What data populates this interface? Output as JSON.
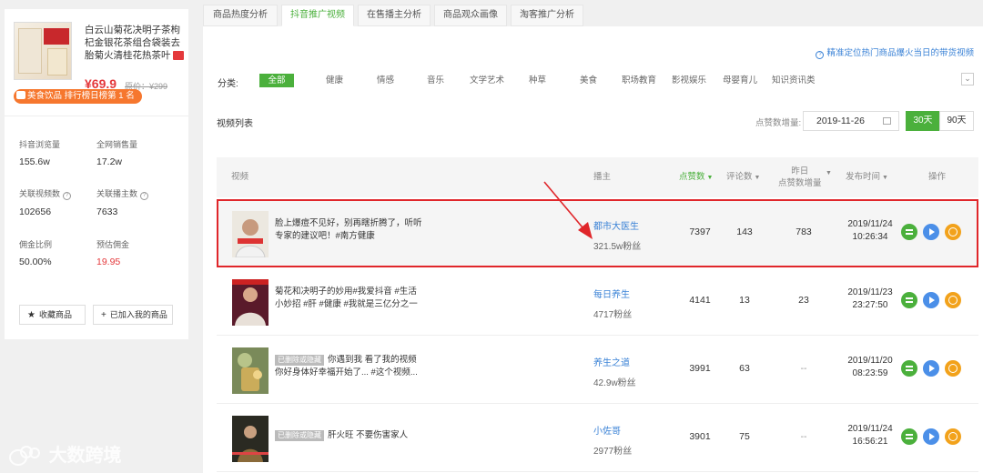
{
  "product": {
    "title": "白云山菊花决明子茶枸杞金银花茶组合袋装去胎菊火清桂花热茶叶",
    "price": "¥69.9",
    "orig_label": "原价",
    "orig_price": "¥299",
    "rank_badge": "美食饮品 排行榜日榜第 1 名"
  },
  "stats": [
    {
      "label": "抖音浏览量",
      "value": "155.6w"
    },
    {
      "label": "全网销售量",
      "value": "17.2w"
    },
    {
      "label": "关联视频数",
      "value": "102656"
    },
    {
      "label": "关联播主数",
      "value": "7633"
    },
    {
      "label": "佣金比例",
      "value": "50.00%"
    },
    {
      "label": "预估佣金",
      "value": "19.95"
    }
  ],
  "left_buttons": {
    "favorite": "收藏商品",
    "add": "已加入我的商品",
    "star_glyph": "★",
    "plus_glyph": "+"
  },
  "tabs": [
    "商品热度分析",
    "抖音推广视频",
    "在售播主分析",
    "商品观众画像",
    "淘客推广分析"
  ],
  "hint": "精准定位热门商品爆火当日的带货视频",
  "category_label": "分类:",
  "categories": [
    "全部",
    "健康",
    "情感",
    "音乐",
    "文学艺术",
    "种草",
    "美食",
    "职场教育",
    "影视娱乐",
    "母婴育儿",
    "知识资讯类"
  ],
  "list_title": "视频列表",
  "date_filter": {
    "label": "点赞数增量:",
    "date": "2019-11-26",
    "btn30": "30天",
    "btn90": "90天"
  },
  "columns": {
    "video": "视频",
    "author": "播主",
    "likes": "点赞数",
    "comments": "评论数",
    "daily_line1": "昨日",
    "daily_line2": "点赞数增量",
    "time": "发布时间",
    "ops": "操作"
  },
  "rows": [
    {
      "title": "脸上爆痘不见好，别再瞎折腾了，听听专家的建议吧！#南方健康",
      "tag": "",
      "author": "都市大医生",
      "fans": "321.5w粉丝",
      "likes": "7397",
      "comments": "143",
      "daily": "783",
      "date": "2019/11/24",
      "time": "10:26:34"
    },
    {
      "title": "菊花和决明子的妙用#我爱抖音 #生活小妙招 #肝 #健康 #我就是三亿分之一",
      "tag": "",
      "author": "每日养生",
      "fans": "4717粉丝",
      "likes": "4141",
      "comments": "13",
      "daily": "23",
      "date": "2019/11/23",
      "time": "23:27:50"
    },
    {
      "title": "你遇到我 看了我的视频你好身体好幸福开始了... #这个视频...",
      "tag": "已删除或隐藏",
      "author": "养生之道",
      "fans": "42.9w粉丝",
      "likes": "3991",
      "comments": "63",
      "daily": "--",
      "date": "2019/11/20",
      "time": "08:23:59"
    },
    {
      "title": "肝火旺 不要伤害家人",
      "tag": "已删除或隐藏",
      "author": "小佐哥",
      "fans": "2977粉丝",
      "likes": "3901",
      "comments": "75",
      "daily": "--",
      "date": "2019/11/24",
      "time": "16:56:21"
    }
  ],
  "watermark": "大数跨境",
  "colors": {
    "accent": "#4bb03c",
    "link": "#3a82d6",
    "price": "#e4393c",
    "highlight": "#e0262a"
  }
}
